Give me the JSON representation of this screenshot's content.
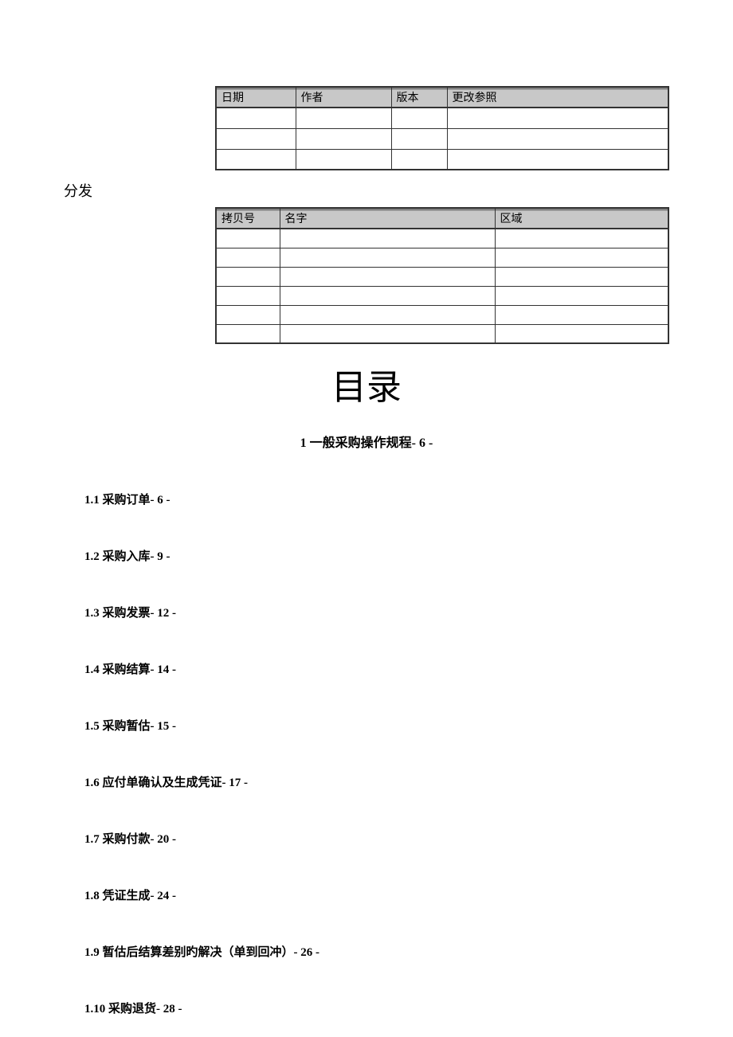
{
  "historyTable": {
    "headers": {
      "date": "日期",
      "author": "作者",
      "version": "版本",
      "changeRef": "更改参照"
    }
  },
  "distributionSection": {
    "heading": "分发"
  },
  "distributionTable": {
    "headers": {
      "copyNo": "拷贝号",
      "name": "名字",
      "region": "区域"
    }
  },
  "toc": {
    "title": "目录",
    "main": "1 一般采购操作规程- 6 -",
    "items": [
      "1.1 采购订单- 6 -",
      "1.2 采购入库- 9 -",
      "1.3 采购发票- 12 -",
      "1.4 采购结算- 14 -",
      "1.5 采购暂估- 15 -",
      "1.6 应付单确认及生成凭证- 17 -",
      "1.7 采购付款- 20 -",
      "1.8 凭证生成- 24 -",
      "1.9 暂估后结算差别旳解决（单到回冲）- 26 -",
      "1.10 采购退货- 28 -"
    ]
  }
}
